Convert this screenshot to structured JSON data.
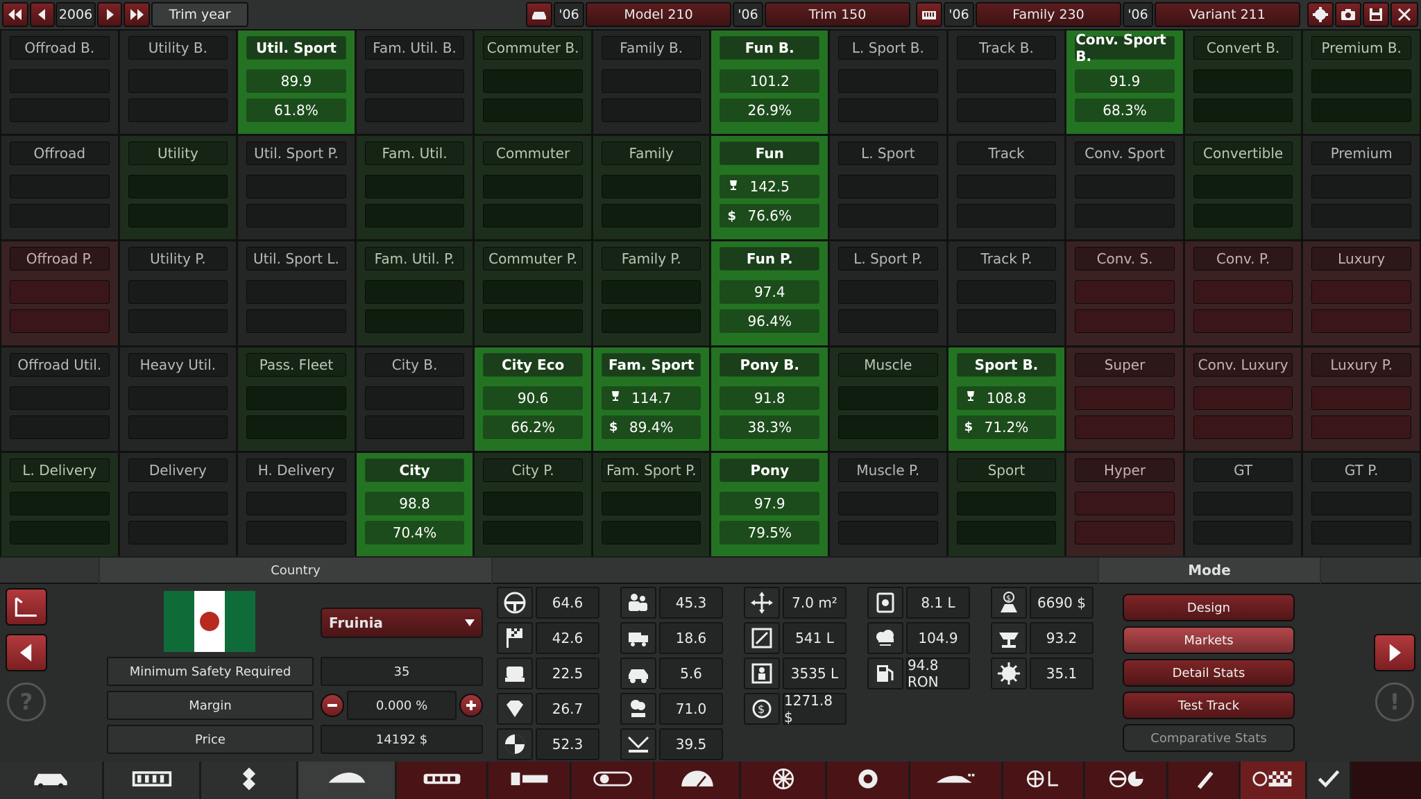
{
  "top": {
    "year": "2006",
    "trim_year_label": "Trim year",
    "model_year": "'06",
    "model_name": "Model 210",
    "trim_year": "'06",
    "trim_name": "Trim 150",
    "family_year": "'06",
    "family_name": "Family 230",
    "variant_year": "'06",
    "variant_name": "Variant 211"
  },
  "grid": [
    [
      {
        "label": "Offroad B.",
        "state": 0
      },
      {
        "label": "Utility B.",
        "state": 0
      },
      {
        "label": "Util. Sport",
        "state": 2,
        "v1": "89.9",
        "v2": "61.8%"
      },
      {
        "label": "Fam. Util. B.",
        "state": 0
      },
      {
        "label": "Commuter B.",
        "state": 1
      },
      {
        "label": "Family B.",
        "state": 0
      },
      {
        "label": "Fun B.",
        "state": 2,
        "v1": "101.2",
        "v2": "26.9%"
      },
      {
        "label": "L. Sport B.",
        "state": 0
      },
      {
        "label": "Track B.",
        "state": 0
      },
      {
        "label": "Conv. Sport B.",
        "state": 2,
        "v1": "91.9",
        "v2": "68.3%"
      },
      {
        "label": "Convert B.",
        "state": 1
      },
      {
        "label": "Premium B.",
        "state": 1
      }
    ],
    [
      {
        "label": "Offroad",
        "state": 0
      },
      {
        "label": "Utility",
        "state": 1
      },
      {
        "label": "Util. Sport P.",
        "state": 0
      },
      {
        "label": "Fam. Util.",
        "state": 1
      },
      {
        "label": "Commuter",
        "state": 1
      },
      {
        "label": "Family",
        "state": 1
      },
      {
        "label": "Fun",
        "state": 2,
        "v1": "142.5",
        "v2": "76.6%",
        "p1": "trophy",
        "p2": "$"
      },
      {
        "label": "L. Sport",
        "state": 0
      },
      {
        "label": "Track",
        "state": 0
      },
      {
        "label": "Conv. Sport",
        "state": 0
      },
      {
        "label": "Convertible",
        "state": 1
      },
      {
        "label": "Premium",
        "state": 0
      }
    ],
    [
      {
        "label": "Offroad P.",
        "state": 3
      },
      {
        "label": "Utility P.",
        "state": 0
      },
      {
        "label": "Util. Sport L.",
        "state": 0
      },
      {
        "label": "Fam. Util. P.",
        "state": 1
      },
      {
        "label": "Commuter P.",
        "state": 1
      },
      {
        "label": "Family P.",
        "state": 1
      },
      {
        "label": "Fun P.",
        "state": 2,
        "v1": "97.4",
        "v2": "96.4%"
      },
      {
        "label": "L. Sport P.",
        "state": 0
      },
      {
        "label": "Track P.",
        "state": 0
      },
      {
        "label": "Conv. S.",
        "state": 3
      },
      {
        "label": "Conv. P.",
        "state": 3
      },
      {
        "label": "Luxury",
        "state": 3
      }
    ],
    [
      {
        "label": "Offroad Util.",
        "state": 0
      },
      {
        "label": "Heavy Util.",
        "state": 0
      },
      {
        "label": "Pass. Fleet",
        "state": 1
      },
      {
        "label": "City B.",
        "state": 0
      },
      {
        "label": "City Eco",
        "state": 2,
        "v1": "90.6",
        "v2": "66.2%"
      },
      {
        "label": "Fam. Sport",
        "state": 2,
        "v1": "114.7",
        "v2": "89.4%",
        "p1": "trophy",
        "p2": "$"
      },
      {
        "label": "Pony B.",
        "state": 2,
        "v1": "91.8",
        "v2": "38.3%"
      },
      {
        "label": "Muscle",
        "state": 1
      },
      {
        "label": "Sport B.",
        "state": 2,
        "v1": "108.8",
        "v2": "71.2%",
        "p1": "trophy",
        "p2": "$"
      },
      {
        "label": "Super",
        "state": 3
      },
      {
        "label": "Conv. Luxury",
        "state": 3
      },
      {
        "label": "Luxury P.",
        "state": 3
      }
    ],
    [
      {
        "label": "L. Delivery",
        "state": 1
      },
      {
        "label": "Delivery",
        "state": 0
      },
      {
        "label": "H. Delivery",
        "state": 0
      },
      {
        "label": "City",
        "state": 2,
        "v1": "98.8",
        "v2": "70.4%"
      },
      {
        "label": "City P.",
        "state": 1
      },
      {
        "label": "Fam. Sport P.",
        "state": 1
      },
      {
        "label": "Pony",
        "state": 2,
        "v1": "97.9",
        "v2": "79.5%"
      },
      {
        "label": "Muscle P.",
        "state": 0
      },
      {
        "label": "Sport",
        "state": 1
      },
      {
        "label": "Hyper",
        "state": 3
      },
      {
        "label": "GT",
        "state": 0
      },
      {
        "label": "GT P.",
        "state": 0
      }
    ]
  ],
  "country": {
    "header": "Country",
    "selected": "Fruinia",
    "min_safety_label": "Minimum Safety Required",
    "min_safety_value": "35",
    "margin_label": "Margin",
    "margin_value": "0.000 %",
    "price_label": "Price",
    "price_value": "14192 $"
  },
  "stats": {
    "col1": [
      "64.6",
      "42.6",
      "22.5",
      "26.7",
      "52.3"
    ],
    "col2": [
      "45.3",
      "18.6",
      "5.6",
      "71.0",
      "39.5"
    ],
    "col3": [
      "7.0 m²",
      "541 L",
      "3535 L",
      "1271.8 $"
    ],
    "col4": [
      "8.1 L",
      "104.9",
      "94.8 RON"
    ],
    "col5": [
      "6690 $",
      "93.2",
      "35.1"
    ]
  },
  "mode": {
    "header": "Mode",
    "buttons": [
      "Design",
      "Markets",
      "Detail Stats",
      "Test Track",
      "Comparative Stats"
    ]
  },
  "colors": {
    "accent_red": "#7e2527",
    "green_active": "#247323",
    "green_dim": "#1d2e1d",
    "red_dim": "#3a2122"
  }
}
